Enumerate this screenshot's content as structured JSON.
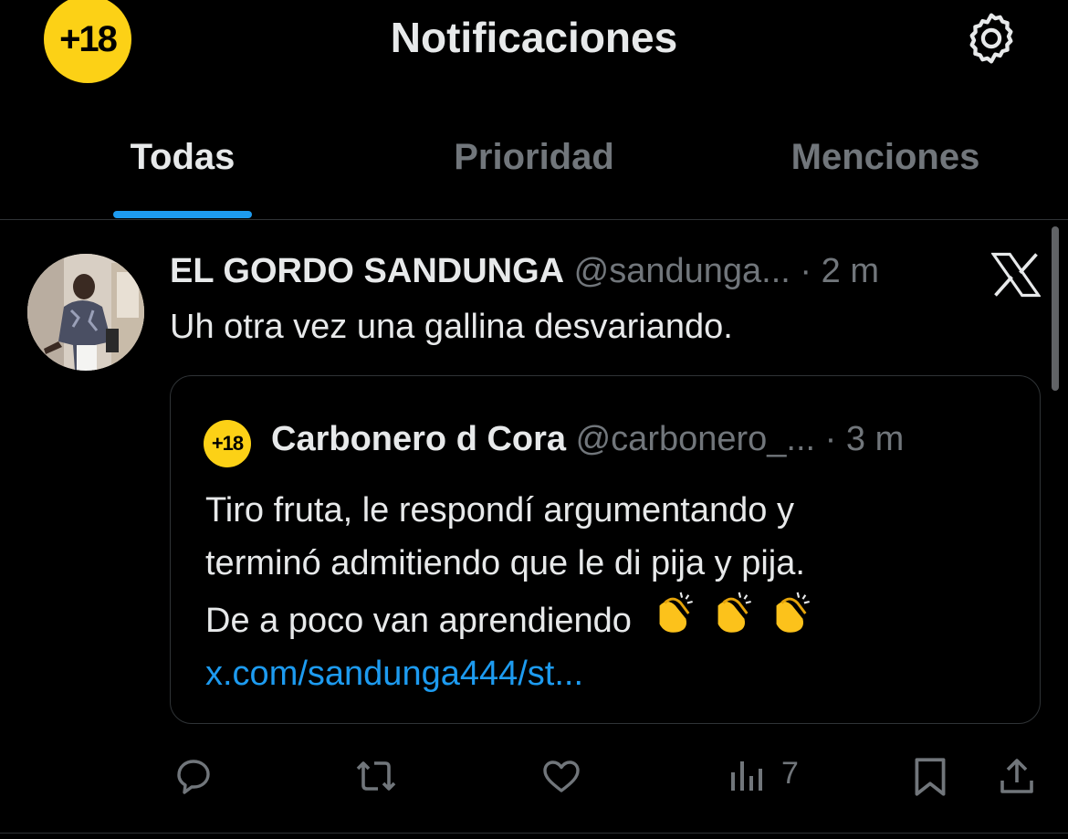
{
  "header": {
    "avatar_text": "+18",
    "title": "Notificaciones"
  },
  "tabs": [
    {
      "label": "Todas",
      "active": true
    },
    {
      "label": "Prioridad",
      "active": false
    },
    {
      "label": "Menciones",
      "active": false
    }
  ],
  "notification": {
    "author_name": "EL GORDO SANDUNGA",
    "author_handle": "@sandunga...",
    "time": "· 2 m",
    "text": "Uh otra vez una gallina desvariando.",
    "quote": {
      "avatar_text": "+18",
      "author_name": "Carbonero d Cora",
      "author_handle": "@carbonero_...",
      "time": "· 3 m",
      "line1": "Tiro fruta, le respondí argumentando y",
      "line2": "terminó admitiendo que le di pija y pija.",
      "line3": "De a poco van aprendiendo",
      "link": "x.com/sandunga444/st..."
    },
    "actions": {
      "views_count": "7"
    }
  },
  "icons": {
    "settings": "gear-icon",
    "platform": "x-logo-icon",
    "reply": "reply-icon",
    "retweet": "retweet-icon",
    "like": "heart-icon",
    "views": "views-icon",
    "bookmark": "bookmark-icon",
    "share": "share-icon"
  },
  "colors": {
    "background": "#000000",
    "accent": "#1d9bf0",
    "avatar_yellow": "#fcd116",
    "muted_text": "#71767b"
  }
}
